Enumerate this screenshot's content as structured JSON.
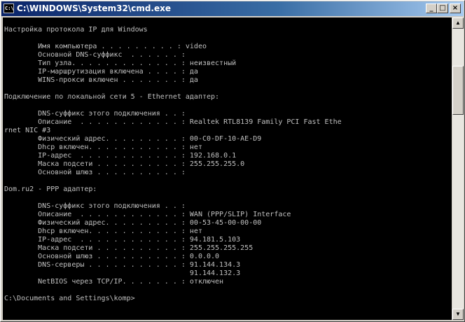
{
  "window": {
    "title": "C:\\WINDOWS\\System32\\cmd.exe",
    "icon": "cmd-icon",
    "buttons": {
      "minimize": "_",
      "maximize": "□",
      "close": "×"
    }
  },
  "console": {
    "lines": [
      "Настройка протокола IP для Windows",
      "",
      "        Имя компьютера . . . . . . . . . : video",
      "        Основной DNS-суффикс  . . . . . . :",
      "        Тип узла. . . . . . . . . . . . . : неизвестный",
      "        IP-маршрутизация включена . . . . : да",
      "        WINS-прокси включен . . . . . . . : да",
      "",
      "Подключение по локальной сети 5 - Ethernet адаптер:",
      "",
      "        DNS-суффикс этого подключения . . :",
      "        Описание  . . . . . . . . . . . . : Realtek RTL8139 Family PCI Fast Ethe",
      "rnet NIC #3",
      "        Физический адрес. . . . . . . . . : 00-C0-DF-10-AE-D9",
      "        Dhcp включен. . . . . . . . . . . : нет",
      "        IP-адрес  . . . . . . . . . . . . : 192.168.0.1",
      "        Маска подсети . . . . . . . . . . : 255.255.255.0",
      "        Основной шлюз . . . . . . . . . . :",
      "",
      "Dom.ru2 - PPP адаптер:",
      "",
      "        DNS-суффикс этого подключения . . :",
      "        Описание  . . . . . . . . . . . . : WAN (PPP/SLIP) Interface",
      "        Физический адрес. . . . . . . . . : 00-53-45-00-00-00",
      "        Dhcp включен. . . . . . . . . . . : нет",
      "        IP-адрес  . . . . . . . . . . . . : 94.181.5.103",
      "        Маска подсети . . . . . . . . . . : 255.255.255.255",
      "        Основной шлюз . . . . . . . . . . : 0.0.0.0",
      "        DNS-серверы . . . . . . . . . . . : 91.144.134.3",
      "                                            91.144.132.3",
      "        NetBIOS через TCP/IP. . . . . . . : отключен",
      "",
      "C:\\Documents and Settings\\komp>"
    ]
  },
  "scrollbar": {
    "up_icon": "scroll-up-arrow-icon",
    "down_icon": "scroll-down-arrow-icon",
    "up_glyph": "▲",
    "down_glyph": "▼"
  }
}
